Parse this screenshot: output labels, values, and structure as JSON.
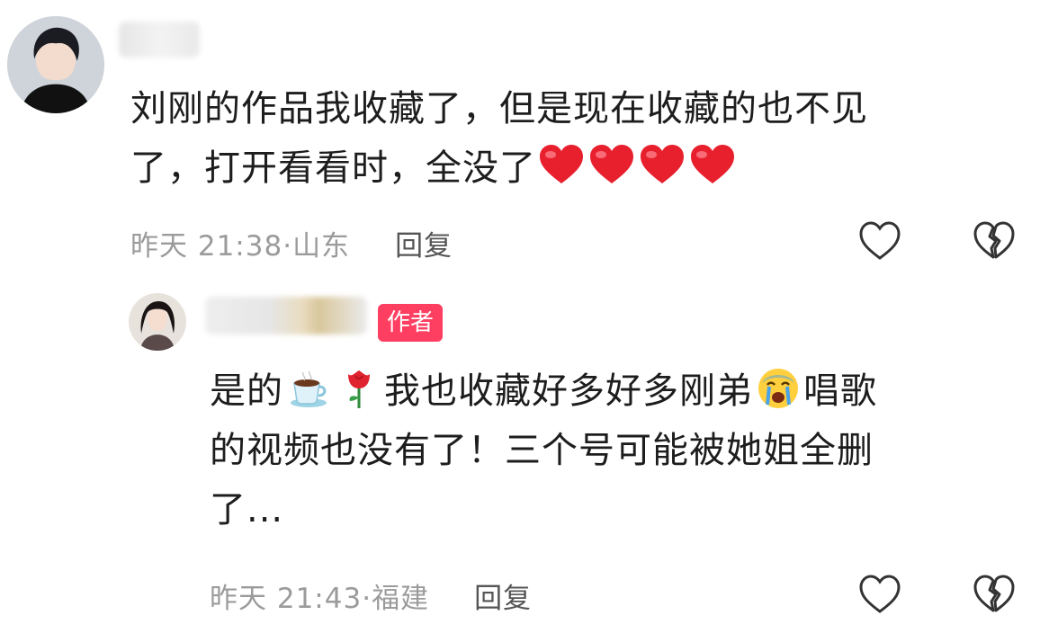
{
  "comments": [
    {
      "text_line1": "刘刚的作品我收藏了，但是现在收藏的也不见",
      "text_line2": "了，打开看看时，全没了",
      "emojis": [
        "heart-emoji",
        "heart-emoji",
        "heart-emoji",
        "heart-emoji"
      ],
      "time": "昨天 21:38",
      "sep": "·",
      "location": "山东",
      "reply_label": "回复",
      "like_icon": "heart-outline-icon",
      "dislike_icon": "broken-heart-icon"
    },
    {
      "badge": "作者",
      "text_a": "是的",
      "text_b": "我也收藏好多好多刚弟",
      "text_c": "唱歌",
      "text_line2": "的视频也没有了！三个号可能被她姐全删",
      "text_line3": "了...",
      "emojis": [
        "coffee-emoji",
        "rose-emoji",
        "crying-face-emoji"
      ],
      "time": "昨天 21:43",
      "sep": "·",
      "location": "福建",
      "reply_label": "回复",
      "like_icon": "heart-outline-icon",
      "dislike_icon": "broken-heart-icon"
    }
  ],
  "colors": {
    "badge": "#ff3f62",
    "meta": "#9b9b9b",
    "heart": "#e8202e"
  }
}
